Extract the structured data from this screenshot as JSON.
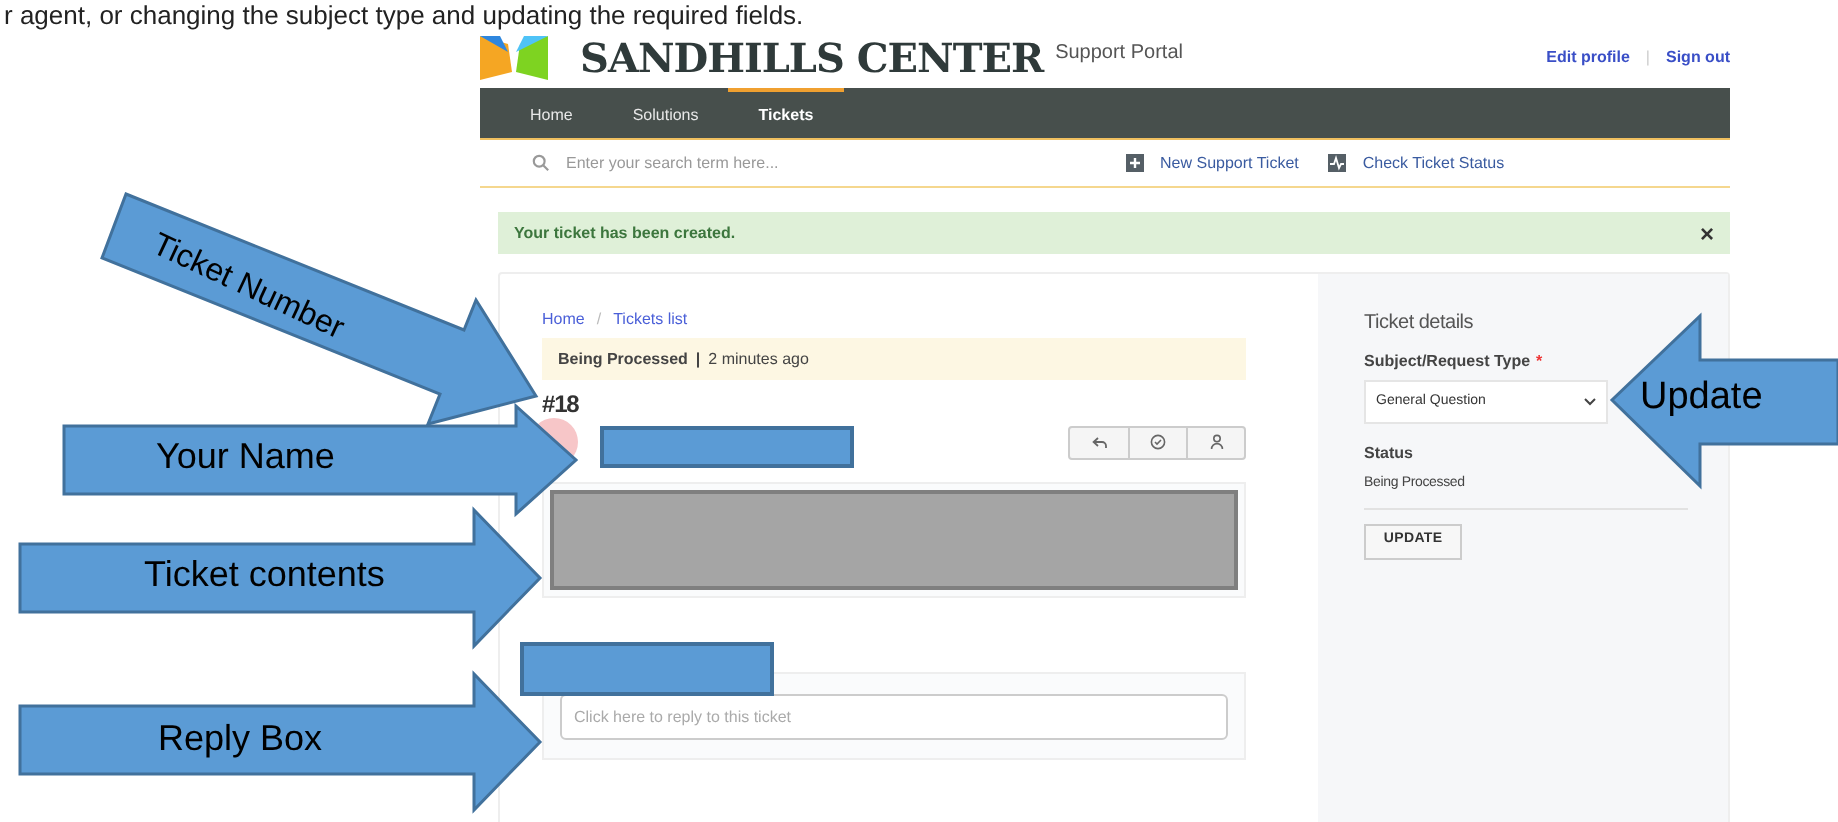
{
  "caption": "r agent, or changing the subject type and updating the required fields.",
  "header": {
    "brand": "SANDHILLS CENTER",
    "subtitle": "Support Portal",
    "links": [
      "Edit profile",
      "Sign out"
    ],
    "separator": "|"
  },
  "nav": [
    {
      "label": "Home",
      "selected": false
    },
    {
      "label": "Solutions",
      "selected": false
    },
    {
      "label": "Tickets",
      "selected": true
    }
  ],
  "search": {
    "placeholder": "Enter your search term here..."
  },
  "actions": [
    {
      "kind": "new",
      "label": "New Support Ticket"
    },
    {
      "kind": "status",
      "label": "Check Ticket Status"
    }
  ],
  "alert": {
    "message": "Your ticket has been created.",
    "close": "×"
  },
  "breadcrumb": [
    "Home",
    "Tickets list"
  ],
  "breadcrumb_separator": "/",
  "ticket": {
    "status": "Being Processed",
    "separator": "|",
    "age": "2 minutes ago",
    "number": "#18"
  },
  "reply": {
    "placeholder": "Click here to reply to this ticket"
  },
  "details": {
    "title": "Ticket details",
    "type_label": "Subject/Request Type",
    "required_mark": "*",
    "type_value": "General Question",
    "status_label": "Status",
    "status_value": "Being Processed",
    "button": "UPDATE"
  },
  "callouts": [
    {
      "label": "Ticket Number"
    },
    {
      "label": "Your Name"
    },
    {
      "label": "Ticket contents"
    },
    {
      "label": "Reply Box"
    },
    {
      "label": "Update"
    }
  ]
}
